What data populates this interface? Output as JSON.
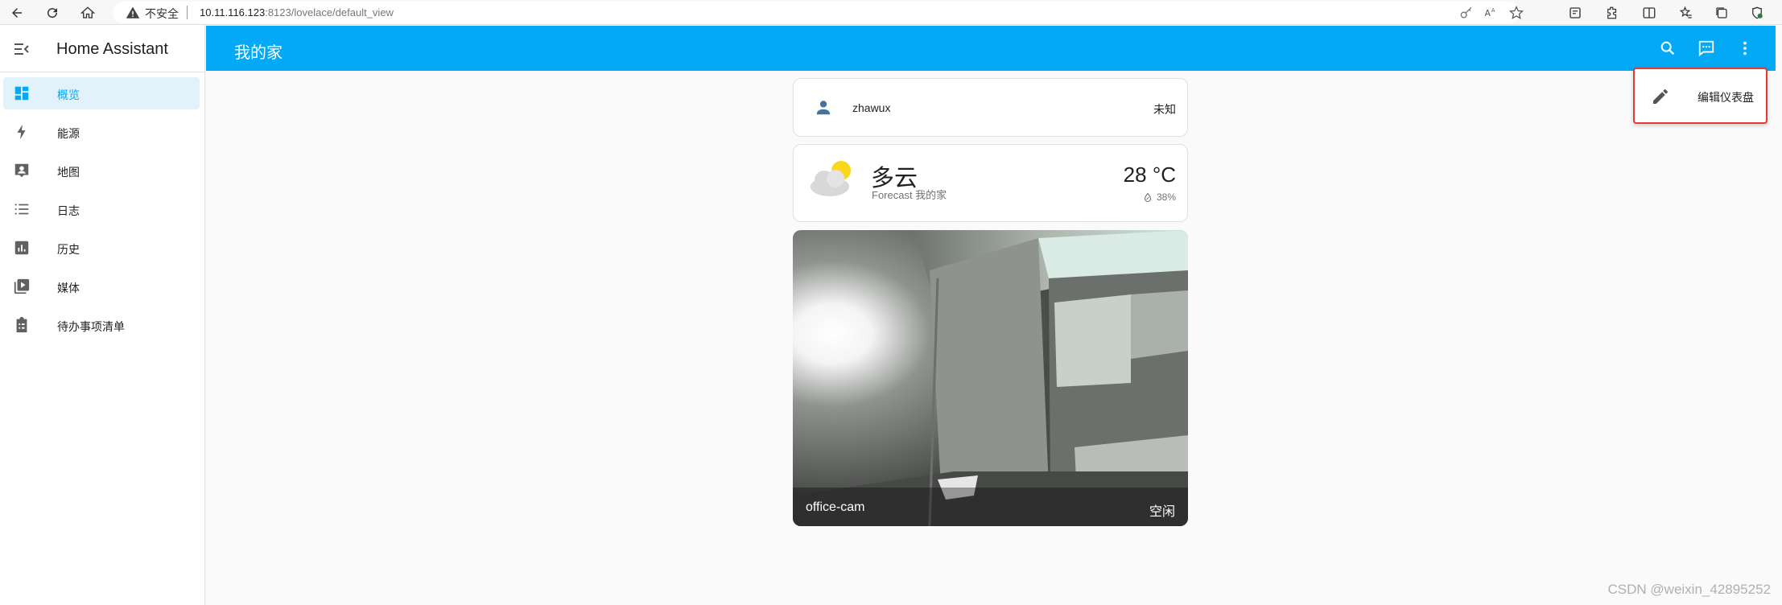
{
  "browser": {
    "insecure_label": "不安全",
    "url_host": "10.11.116.123",
    "url_rest": ":8123/lovelace/default_view"
  },
  "sidebar": {
    "title": "Home Assistant",
    "items": [
      {
        "label": "概览",
        "icon": "dashboard-icon",
        "active": true
      },
      {
        "label": "能源",
        "icon": "lightning-icon",
        "active": false
      },
      {
        "label": "地图",
        "icon": "account-box-icon",
        "active": false
      },
      {
        "label": "日志",
        "icon": "list-icon",
        "active": false
      },
      {
        "label": "历史",
        "icon": "chart-box-icon",
        "active": false
      },
      {
        "label": "媒体",
        "icon": "play-box-icon",
        "active": false
      },
      {
        "label": "待办事项清单",
        "icon": "clipboard-list-icon",
        "active": false
      }
    ]
  },
  "header": {
    "title": "我的家"
  },
  "overflow_menu": {
    "edit_label": "编辑仪表盘"
  },
  "person_card": {
    "name": "zhawux",
    "state": "未知"
  },
  "weather_card": {
    "condition": "多云",
    "subtitle": "Forecast 我的家",
    "temperature": "28 °C",
    "humidity": "38%"
  },
  "camera_card": {
    "name": "office-cam",
    "state": "空闲"
  },
  "watermark": "CSDN @weixin_42895252",
  "colors": {
    "primary": "#03a9f4",
    "sidebar_active_bg": "#e1f2fb",
    "highlight_border": "#e53935"
  }
}
